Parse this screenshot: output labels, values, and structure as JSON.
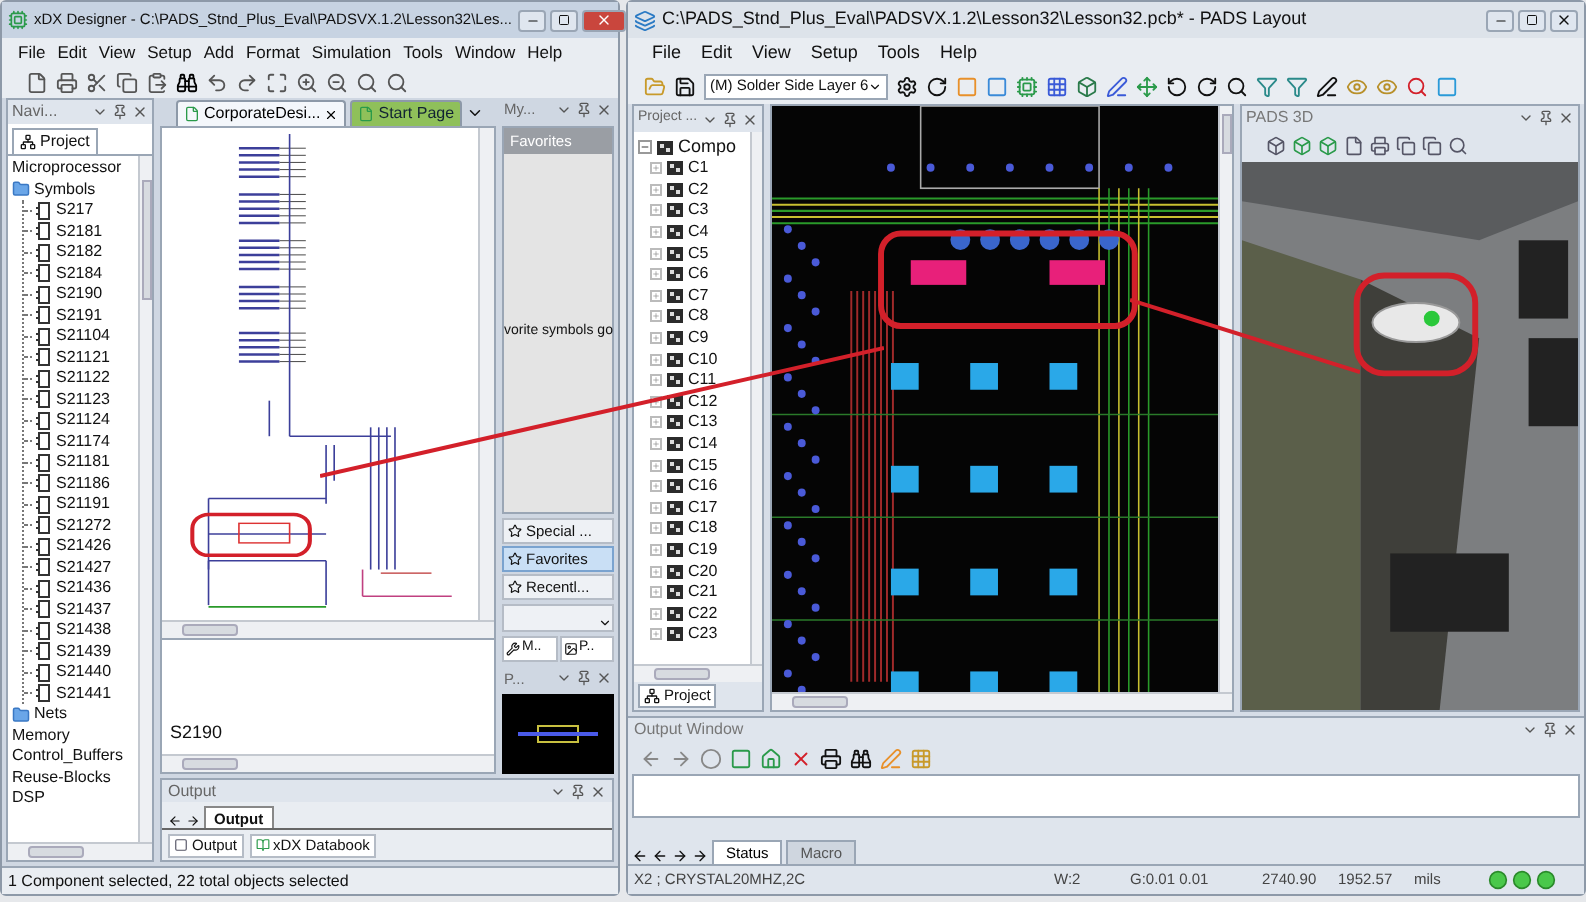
{
  "left_window": {
    "title": "xDX Designer - C:\\PADS_Stnd_Plus_Eval\\PADSVX.1.2\\Lesson32\\Les...",
    "menu": [
      "File",
      "Edit",
      "View",
      "Setup",
      "Add",
      "Format",
      "Simulation",
      "Tools",
      "Window",
      "Help"
    ],
    "navigator": {
      "header": "Navi...",
      "tab": "Project",
      "tree": [
        {
          "label": "Microprocessor",
          "kind": "text"
        },
        {
          "label": "Symbols",
          "kind": "folder",
          "children": [
            {
              "label": "S217"
            },
            {
              "label": "S2181"
            },
            {
              "label": "S2182"
            },
            {
              "label": "S2184"
            },
            {
              "label": "S2190"
            },
            {
              "label": "S2191"
            },
            {
              "label": "S21104"
            },
            {
              "label": "S21121"
            },
            {
              "label": "S21122"
            },
            {
              "label": "S21123"
            },
            {
              "label": "S21124"
            },
            {
              "label": "S21174"
            },
            {
              "label": "S21181"
            },
            {
              "label": "S21186"
            },
            {
              "label": "S21191"
            },
            {
              "label": "S21272"
            },
            {
              "label": "S21426"
            },
            {
              "label": "S21427"
            },
            {
              "label": "S21436"
            },
            {
              "label": "S21437"
            },
            {
              "label": "S21438"
            },
            {
              "label": "S21439"
            },
            {
              "label": "S21440"
            },
            {
              "label": "S21441"
            }
          ]
        },
        {
          "label": "Nets",
          "kind": "folder"
        },
        {
          "label": "Memory",
          "kind": "text"
        },
        {
          "label": "Control_Buffers",
          "kind": "text"
        },
        {
          "label": "Reuse-Blocks",
          "kind": "text"
        },
        {
          "label": "DSP",
          "kind": "text"
        }
      ]
    },
    "doc_tabs": [
      {
        "label": "CorporateDesi...",
        "selected": true
      },
      {
        "label": "Start Page",
        "selected": false
      }
    ],
    "canvas_label": "S2190",
    "side_panel": {
      "header": "My...",
      "favorites_title": "Favorites",
      "hint": "vorite symbols go",
      "buttons": [
        {
          "label": "Special ...",
          "selected": false
        },
        {
          "label": "Favorites",
          "selected": true
        },
        {
          "label": "Recentl...",
          "selected": false
        }
      ],
      "bottom_tabs": [
        "M..",
        "P.."
      ],
      "preview_header": "P..."
    },
    "output": {
      "title": "Output",
      "tab": "Output",
      "buttons": [
        "Output",
        "xDX Databook"
      ]
    },
    "status": "1 Component selected, 22 total objects selected"
  },
  "right_window": {
    "title": "C:\\PADS_Stnd_Plus_Eval\\PADSVX.1.2\\Lesson32\\Lesson32.pcb* - PADS Layout",
    "menu": [
      "File",
      "Edit",
      "View",
      "Setup",
      "Tools",
      "Help"
    ],
    "layer_select": "(M) Solder Side Layer 6",
    "project_panel": {
      "header": "Project ...",
      "tree": [
        {
          "label": "Compo",
          "children": [
            {
              "label": "C1"
            },
            {
              "label": "C2"
            },
            {
              "label": "C3"
            },
            {
              "label": "C4"
            },
            {
              "label": "C5"
            },
            {
              "label": "C6"
            },
            {
              "label": "C7"
            },
            {
              "label": "C8"
            },
            {
              "label": "C9"
            },
            {
              "label": "C10"
            },
            {
              "label": "C11"
            },
            {
              "label": "C12"
            },
            {
              "label": "C13"
            },
            {
              "label": "C14"
            },
            {
              "label": "C15"
            },
            {
              "label": "C16"
            },
            {
              "label": "C17"
            },
            {
              "label": "C18"
            },
            {
              "label": "C19"
            },
            {
              "label": "C20"
            },
            {
              "label": "C21"
            },
            {
              "label": "C22"
            },
            {
              "label": "C23"
            }
          ]
        }
      ],
      "tab": "Project"
    },
    "view3d": {
      "title": "PADS 3D"
    },
    "output": {
      "title": "Output Window",
      "tabs": [
        {
          "label": "Status",
          "selected": true
        },
        {
          "label": "Macro",
          "selected": false
        }
      ]
    },
    "status_bar": [
      "X2 ; CRYSTAL20MHZ,2C",
      "W:2",
      "G:0.01 0.01",
      "2740.90",
      "1952.57",
      "mils"
    ]
  }
}
